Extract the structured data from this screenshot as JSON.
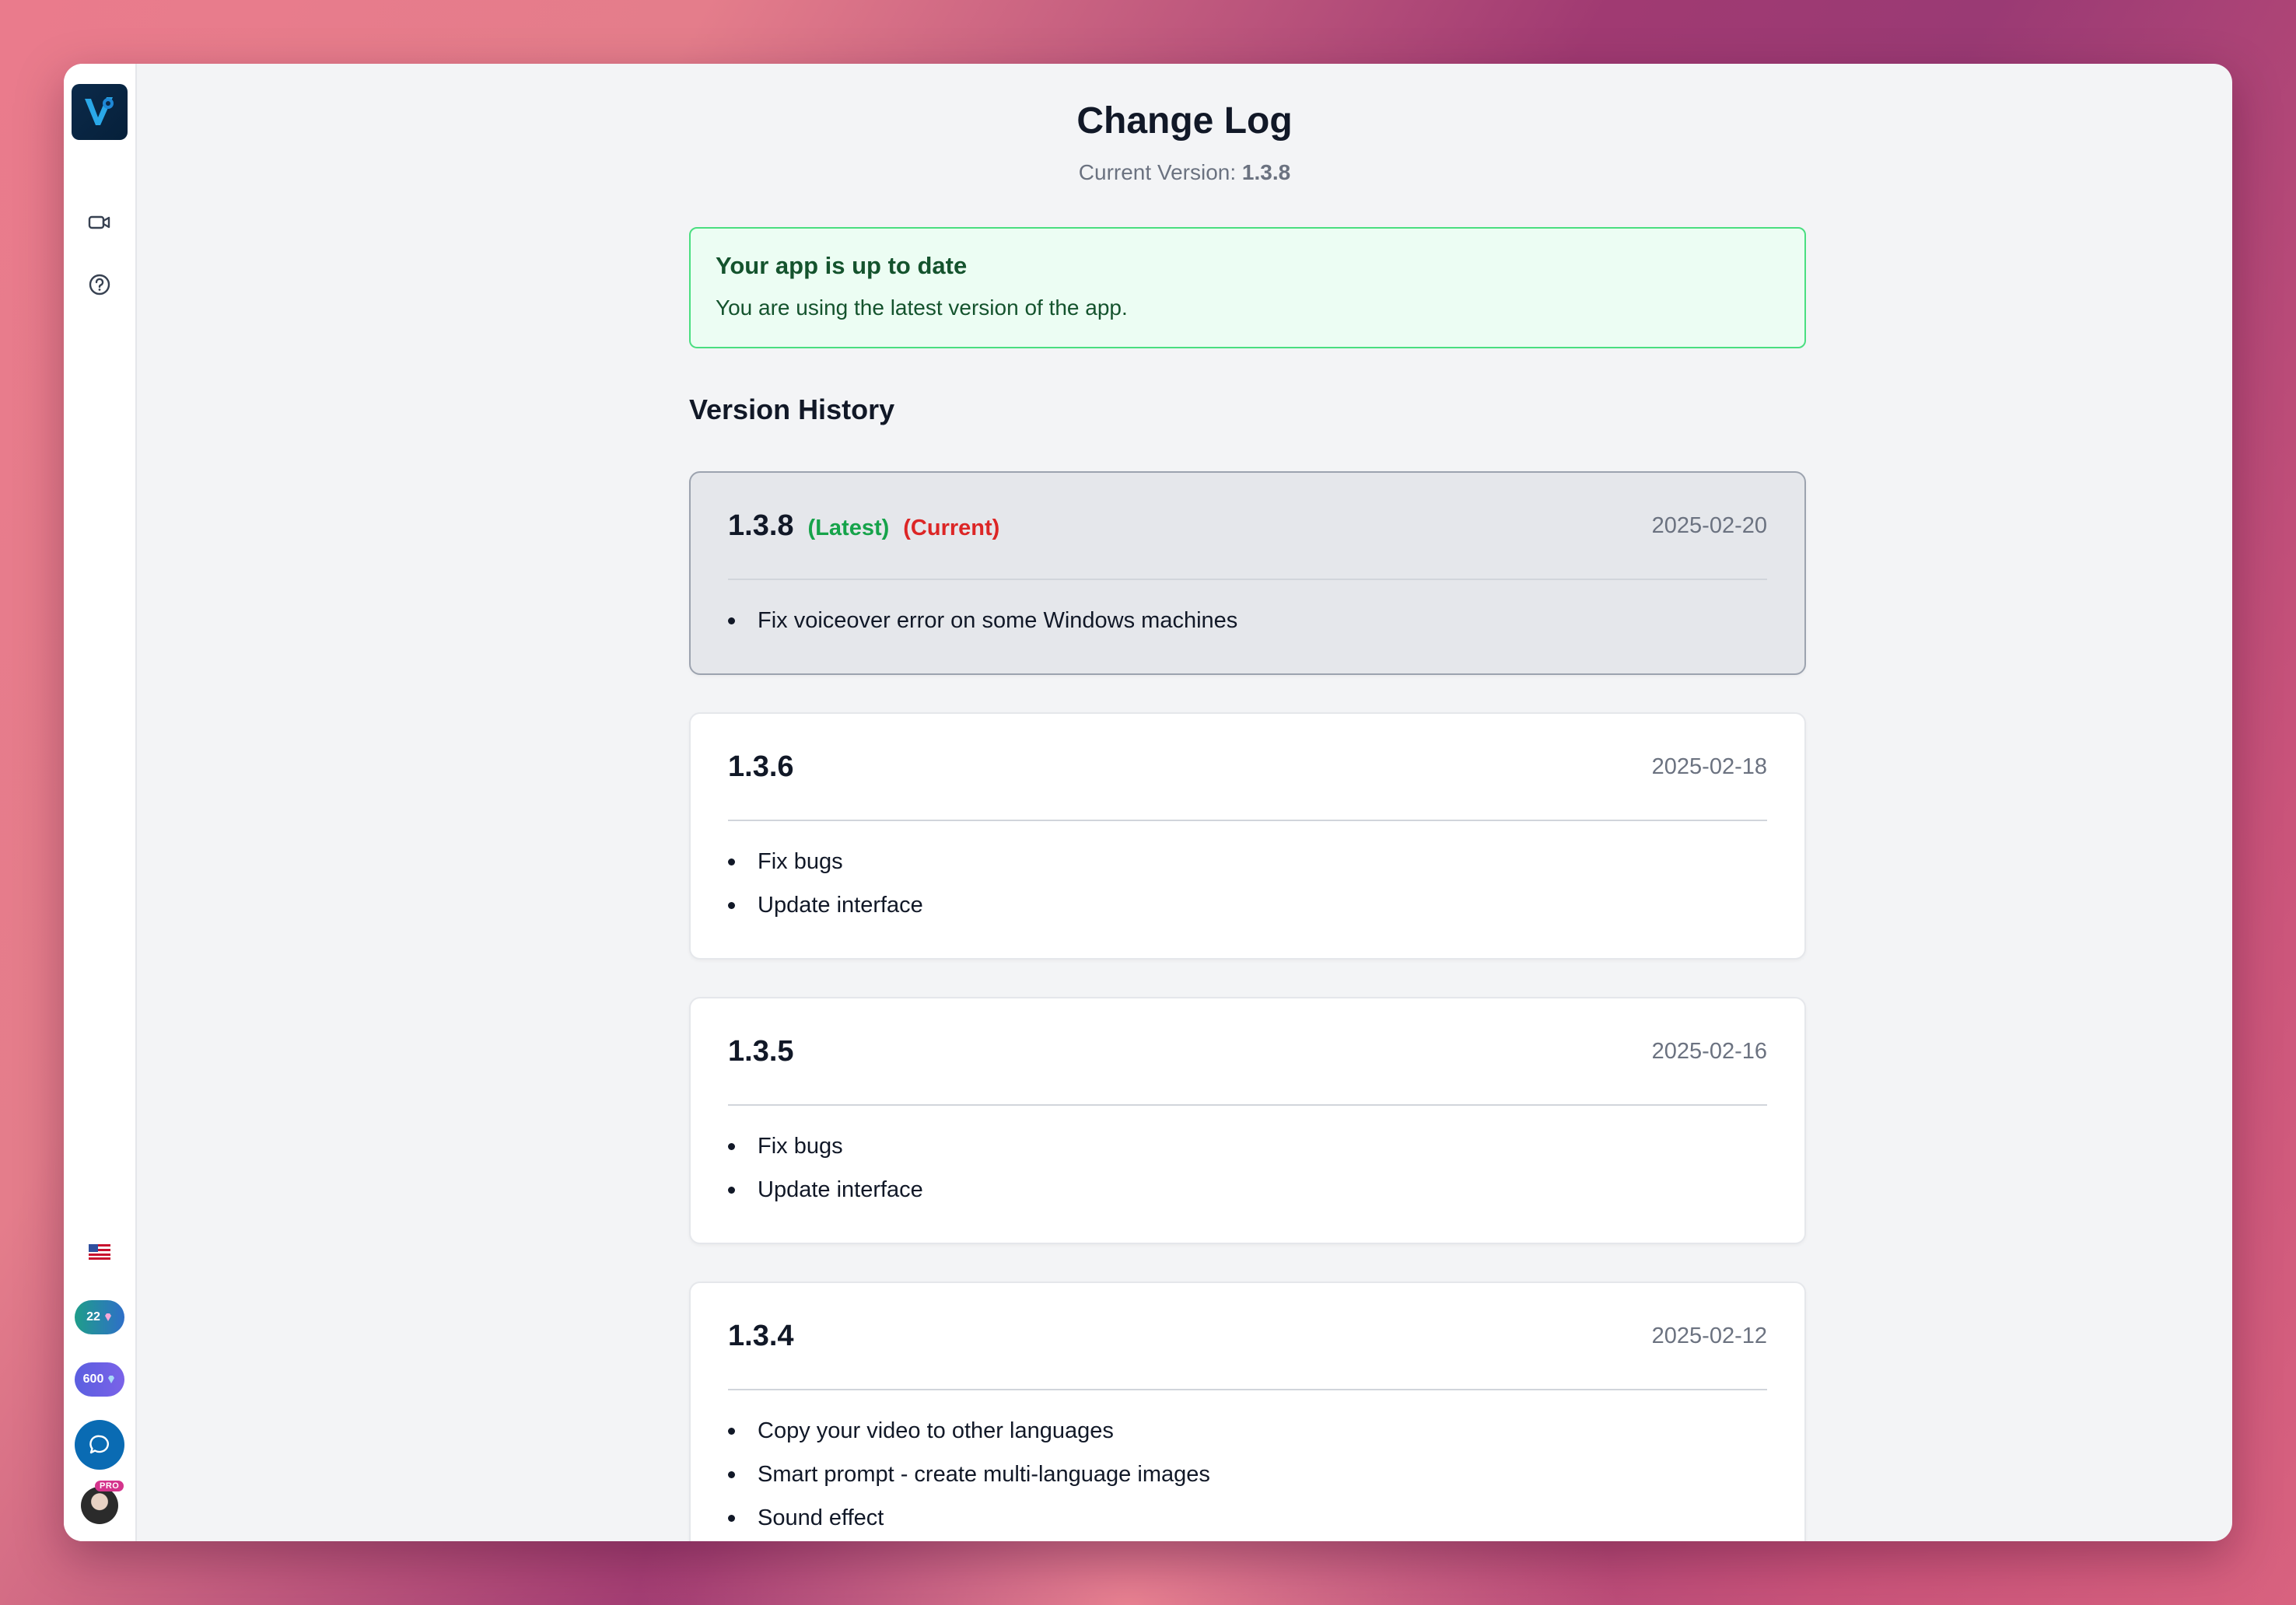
{
  "page": {
    "title": "Change Log",
    "current_version_label": "Current Version:",
    "current_version": "1.3.8"
  },
  "status": {
    "title": "Your app is up to date",
    "text": "You are using the latest version of the app."
  },
  "history": {
    "title": "Version History",
    "versions": [
      {
        "version": "1.3.8",
        "latest_tag": "(Latest)",
        "current_tag": "(Current)",
        "date": "2025-02-20",
        "changes": [
          "Fix voiceover error on some Windows machines"
        ]
      },
      {
        "version": "1.3.6",
        "date": "2025-02-18",
        "changes": [
          "Fix bugs",
          "Update interface"
        ]
      },
      {
        "version": "1.3.5",
        "date": "2025-02-16",
        "changes": [
          "Fix bugs",
          "Update interface"
        ]
      },
      {
        "version": "1.3.4",
        "date": "2025-02-12",
        "changes": [
          "Copy your video to other languages",
          "Smart prompt - create multi-language images",
          "Sound effect"
        ]
      }
    ]
  },
  "sidebar": {
    "credits_a": "22",
    "credits_b": "600",
    "pro_badge": "PRO",
    "icons": [
      "video-camera-icon",
      "help-circle-icon",
      "us-flag-icon",
      "gem-icon",
      "chat-icon"
    ]
  },
  "colors": {
    "accent_green": "#16a34a",
    "accent_red": "#dc2626",
    "status_border": "#4ade80",
    "status_bg": "#ecfdf3"
  }
}
